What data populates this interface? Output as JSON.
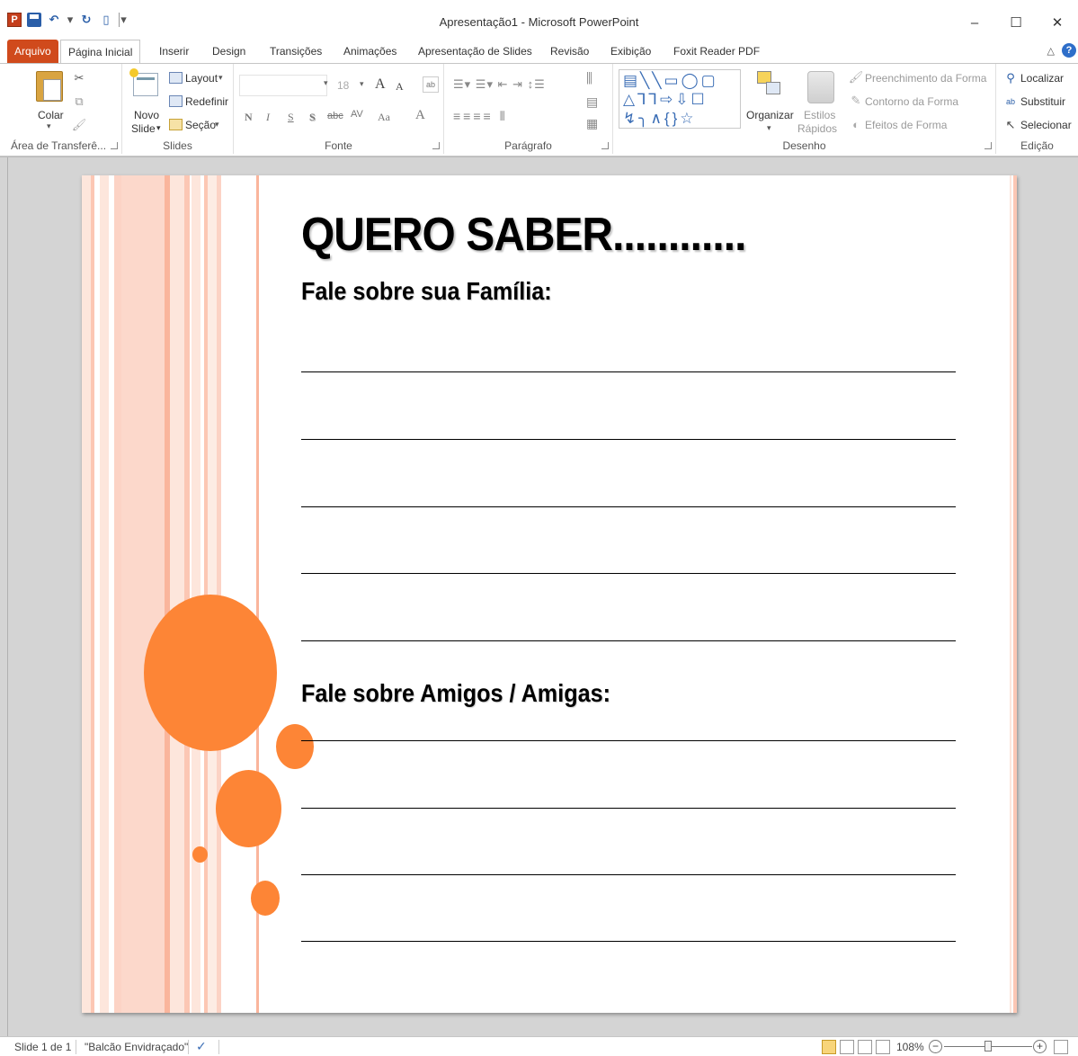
{
  "window": {
    "title": "Apresentação1 - Microsoft PowerPoint",
    "app_icon": "P",
    "minimize_glyph": "–",
    "maximize_glyph": "☐",
    "close_glyph": "✕"
  },
  "qat": {
    "icons": [
      "powerpoint-logo",
      "save-icon",
      "undo-icon",
      "redo-icon",
      "new-document-icon",
      "customize-qat-icon"
    ],
    "undo_glyph": "↶",
    "redo_glyph": "↻",
    "new_glyph": "▯",
    "customize_glyph": "▾"
  },
  "tabs": [
    {
      "label": "Arquivo"
    },
    {
      "label": "Página Inicial"
    },
    {
      "label": "Inserir"
    },
    {
      "label": "Design"
    },
    {
      "label": "Transições"
    },
    {
      "label": "Animações"
    },
    {
      "label": "Apresentação de Slides"
    },
    {
      "label": "Revisão"
    },
    {
      "label": "Exibição"
    },
    {
      "label": "Foxit Reader PDF"
    }
  ],
  "active_tab": "Página Inicial",
  "ribbon": {
    "clipboard": {
      "label": "Área de Transferê...",
      "paste": "Colar",
      "cut_glyph": "✂",
      "copy_glyph": "⧉",
      "format_painter_glyph": "🖌"
    },
    "slides": {
      "label": "Slides",
      "new_slide_line1": "Novo",
      "new_slide_line2": "Slide",
      "layout": "Layout",
      "reset": "Redefinir",
      "section": "Seção"
    },
    "font": {
      "label": "Fonte",
      "size": "18",
      "grow": "A",
      "shrink": "A",
      "bold": "N",
      "italic": "I",
      "underline": "S",
      "shadow": "S",
      "strike": "abc",
      "spacing": "AV",
      "case": "Aa",
      "color": "A"
    },
    "paragraph": {
      "label": "Parágrafo"
    },
    "drawing": {
      "label": "Desenho",
      "arrange": "Organizar",
      "quick_styles_line1": "Estilos",
      "quick_styles_line2": "Rápidos",
      "fill": "Preenchimento da Forma",
      "outline": "Contorno da Forma",
      "effects": "Efeitos de Forma",
      "shapes_row1": "▤╲╲▭◯▢",
      "shapes_row2": "△⅂⅂⇨⇩☐",
      "shapes_row3": "↯╮∧{}☆"
    },
    "editing": {
      "label": "Edição",
      "find": "Localizar",
      "replace": "Substituir",
      "select": "Selecionar"
    }
  },
  "slide": {
    "title": "QUERO SABER............",
    "heading1": "Fale sobre sua Família:",
    "heading2": "Fale sobre Amigos / Amigas:",
    "accent_color": "#fd8536",
    "stripe_color": "#fcd3c5"
  },
  "status": {
    "slide_of": "Slide 1 de 1",
    "theme": "\"Balcão Envidraçado\"",
    "zoom": "108%",
    "zoom_fraction": 0.5
  }
}
